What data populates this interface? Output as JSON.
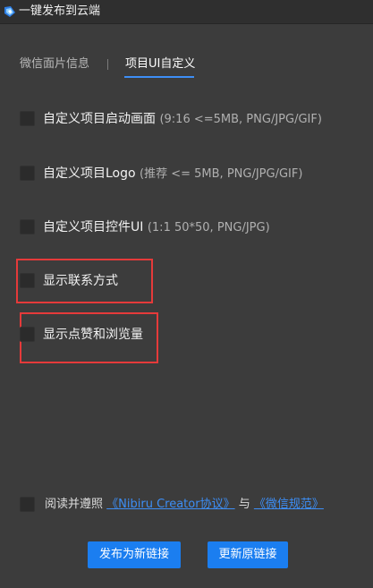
{
  "window": {
    "title": "一键发布到云端",
    "icon": "cloud-app-icon"
  },
  "tabs": [
    {
      "label": "微信面片信息",
      "active": false
    },
    {
      "label": "项目UI自定义",
      "active": true
    }
  ],
  "options": [
    {
      "label": "自定义项目启动画面",
      "hint": "(9:16 <=5MB, PNG/JPG/GIF)",
      "checked": false
    },
    {
      "label": "自定义项目Logo",
      "hint": "(推荐 <= 5MB, PNG/JPG/GIF)",
      "checked": false
    },
    {
      "label": "自定义项目控件UI",
      "hint": "(1:1 50*50, PNG/JPG)",
      "checked": false
    },
    {
      "label": "显示联系方式",
      "hint": "",
      "checked": false
    },
    {
      "label": "显示点赞和浏览量",
      "hint": "",
      "checked": false
    }
  ],
  "agreement": {
    "prefix": "阅读并遵照",
    "link1": "《Nibiru Creator协议》",
    "conj": "与",
    "link2": "《微信规范》",
    "checked": false
  },
  "buttons": {
    "publish_new": "发布为新链接",
    "update_original": "更新原链接"
  },
  "colors": {
    "accent": "#1b7ef0",
    "highlight_box": "#e53a3a",
    "background": "#3c3c3c"
  }
}
